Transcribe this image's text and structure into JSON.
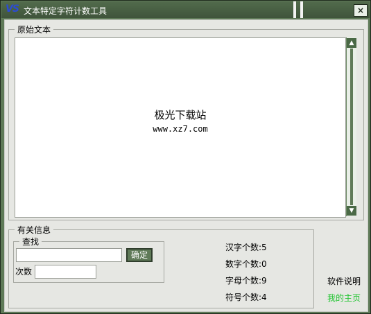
{
  "window": {
    "logo": "VS",
    "title": "文本特定字符计数工具",
    "close": "×"
  },
  "original_text": {
    "legend": "原始文本",
    "content_line1": "极光下载站",
    "content_line2": "www.xz7.com",
    "scroll_up": "▲",
    "scroll_down": "▼"
  },
  "info": {
    "legend": "有关信息",
    "find_legend": "查找",
    "confirm_button": "确定",
    "count_label": "次数",
    "search_value": "",
    "count_value": ""
  },
  "stats": {
    "hanzi": "汉字个数:5",
    "digits": "数字个数:0",
    "letters": "字母个数:9",
    "symbols": "符号个数:4"
  },
  "links": {
    "help": "软件说明",
    "homepage": "我的主页"
  },
  "colors": {
    "frame": "#5f7a58",
    "homepage_link": "#22c532"
  }
}
